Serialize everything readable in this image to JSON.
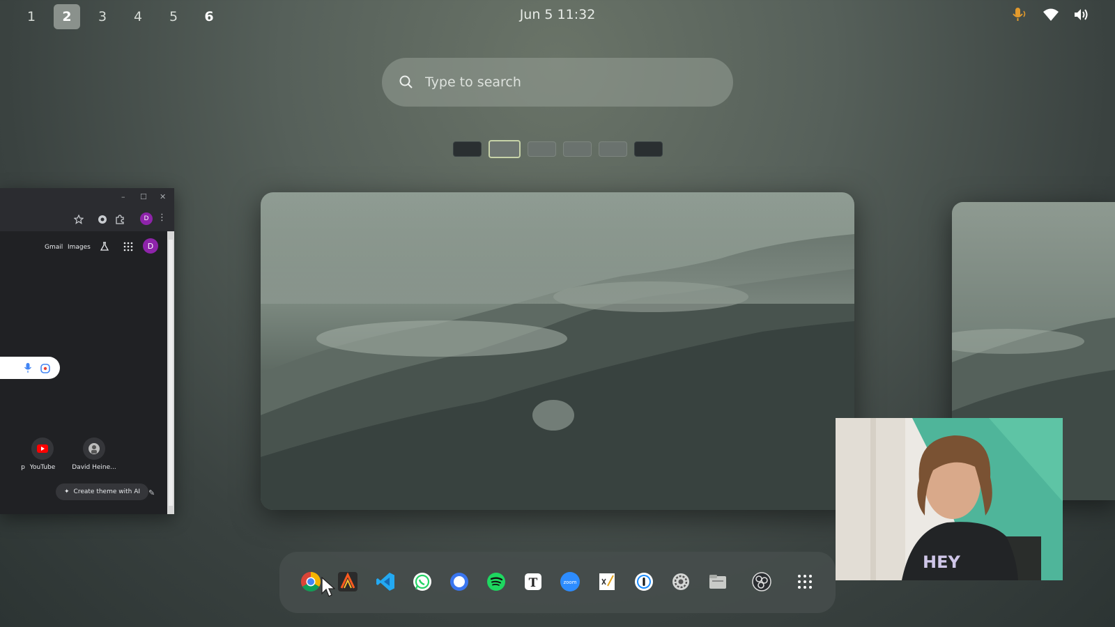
{
  "topbar": {
    "workspaces": [
      "1",
      "2",
      "3",
      "4",
      "5",
      "6"
    ],
    "active_workspace": "2",
    "clock": "Jun 5  11:32",
    "tray_icons": [
      "microphone-icon",
      "wifi-icon",
      "volume-icon"
    ]
  },
  "search": {
    "placeholder": "Type to search"
  },
  "workspace_thumbnails": [
    "1",
    "2",
    "3",
    "4",
    "5",
    "6"
  ],
  "chrome_window": {
    "controls": [
      "–",
      "☐",
      "✕"
    ],
    "toolbar_icons": [
      "star-icon",
      "extension-icon",
      "puzzle-icon",
      "profile-icon",
      "more-icon"
    ],
    "profile_initial": "D",
    "links": {
      "gmail": "Gmail",
      "images": "Images"
    },
    "account_initial": "D",
    "shortcut_left_fragment": "p",
    "shortcuts": [
      {
        "label": "YouTube"
      },
      {
        "label": "David Heine..."
      }
    ],
    "create_theme_label": "Create theme with AI"
  },
  "dock": {
    "apps": [
      "chrome-icon",
      "typora-icon",
      "vscode-icon",
      "whatsapp-icon",
      "signal-icon",
      "spotify-icon",
      "typora-t-icon",
      "zoom-icon",
      "xournal-icon",
      "onepassword-icon",
      "settings-icon",
      "files-icon",
      "obs-icon",
      "app-grid-icon"
    ],
    "zoom_label": "zoom"
  },
  "colors": {
    "workspace_active_bg": "#8a918c",
    "search_bg": "#969e96",
    "chrome_bg": "#202124",
    "chrome_avatar": "#8e24aa",
    "thumb_active_border": "#c7d2a8"
  }
}
